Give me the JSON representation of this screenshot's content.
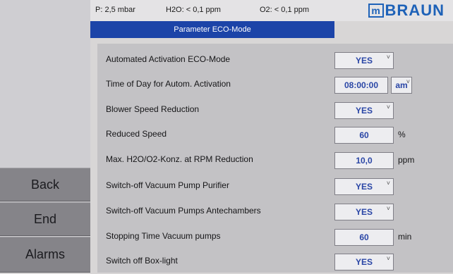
{
  "status": {
    "pressure": "P: 2,5 mbar",
    "h2o": "H2O: < 0,1 ppm",
    "o2": "O2: < 0,1 ppm"
  },
  "brand": {
    "logo_letter": "m",
    "logo_text": "BRAUN"
  },
  "title": "Parameter ECO-Mode",
  "nav": {
    "back": "Back",
    "end": "End",
    "alarms": "Alarms"
  },
  "rows": [
    {
      "label": "Automated Activation ECO-Mode",
      "value": "YES",
      "unit": ""
    },
    {
      "label": "Time of Day for Autom. Activation",
      "value": "08:00:00",
      "unit": "am"
    },
    {
      "label": "Blower Speed Reduction",
      "value": "YES",
      "unit": ""
    },
    {
      "label": "Reduced Speed",
      "value": "60",
      "unit": "%"
    },
    {
      "label": "Max. H2O/O2-Konz. at RPM Reduction",
      "value": "10,0",
      "unit": "ppm"
    },
    {
      "label": "Switch-off Vacuum Pump Purifier",
      "value": "YES",
      "unit": ""
    },
    {
      "label": "Switch-off Vacuum Pumps Antechambers",
      "value": "YES",
      "unit": ""
    },
    {
      "label": "Stopping Time Vacuum pumps",
      "value": "60",
      "unit": "min"
    },
    {
      "label": "Switch off Box-light",
      "value": "YES",
      "unit": ""
    }
  ],
  "icons": {
    "dropdown": "dropdown-caret-icon"
  }
}
